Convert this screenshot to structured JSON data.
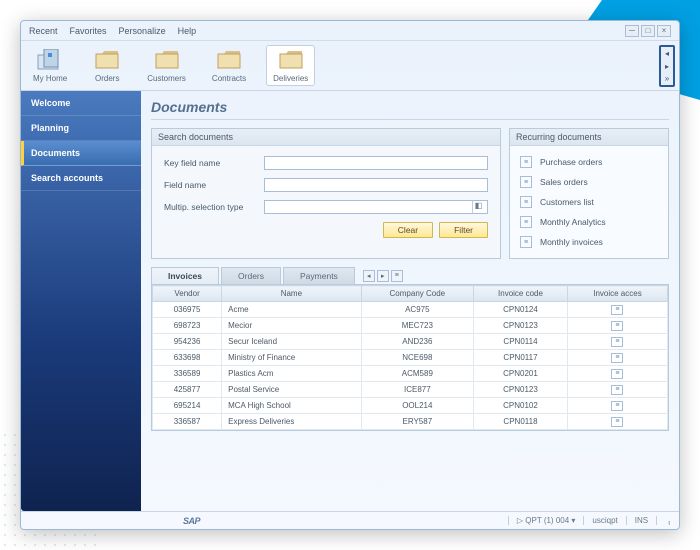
{
  "menu": {
    "recent": "Recent",
    "favorites": "Favorites",
    "personalize": "Personalize",
    "help": "Help"
  },
  "toolbar": {
    "items": [
      {
        "label": "My Home"
      },
      {
        "label": "Orders"
      },
      {
        "label": "Customers"
      },
      {
        "label": "Contracts"
      },
      {
        "label": "Deliveries"
      }
    ]
  },
  "sidebar": {
    "items": [
      {
        "label": "Welcome"
      },
      {
        "label": "Planning"
      },
      {
        "label": "Documents"
      },
      {
        "label": "Search accounts"
      }
    ]
  },
  "page_title": "Documents",
  "search": {
    "header": "Search documents",
    "key_field_label": "Key field name",
    "field_label": "Field name",
    "multip_label": "Multip. selection type",
    "clear": "Clear",
    "filter": "Filter"
  },
  "recurring": {
    "header": "Recurring documents",
    "items": [
      {
        "label": "Purchase orders"
      },
      {
        "label": "Sales orders"
      },
      {
        "label": "Customers list"
      },
      {
        "label": "Monthly Analytics"
      },
      {
        "label": "Monthly invoices"
      }
    ]
  },
  "tabs": [
    {
      "label": "Invoices"
    },
    {
      "label": "Orders"
    },
    {
      "label": "Payments"
    }
  ],
  "grid": {
    "columns": [
      "Vendor",
      "Name",
      "Company Code",
      "Invoice code",
      "Invoice acces"
    ],
    "rows": [
      {
        "vendor": "036975",
        "name": "Acme",
        "cc": "AC975",
        "ic": "CPN0124"
      },
      {
        "vendor": "698723",
        "name": "Mecior",
        "cc": "MEC723",
        "ic": "CPN0123"
      },
      {
        "vendor": "954236",
        "name": "Secur Iceland",
        "cc": "AND236",
        "ic": "CPN0114"
      },
      {
        "vendor": "633698",
        "name": "Ministry of Finance",
        "cc": "NCE698",
        "ic": "CPN0117"
      },
      {
        "vendor": "336589",
        "name": "Plastics Acm",
        "cc": "ACM589",
        "ic": "CPN0201"
      },
      {
        "vendor": "425877",
        "name": "Postal Service",
        "cc": "ICE877",
        "ic": "CPN0123"
      },
      {
        "vendor": "695214",
        "name": "MCA High School",
        "cc": "OOL214",
        "ic": "CPN0102"
      },
      {
        "vendor": "336587",
        "name": "Express Deliveries",
        "cc": "ERY587",
        "ic": "CPN0118"
      }
    ]
  },
  "status": {
    "logo": "SAP",
    "session": "QPT (1) 004",
    "user": "usciqpt",
    "mode": "INS"
  }
}
